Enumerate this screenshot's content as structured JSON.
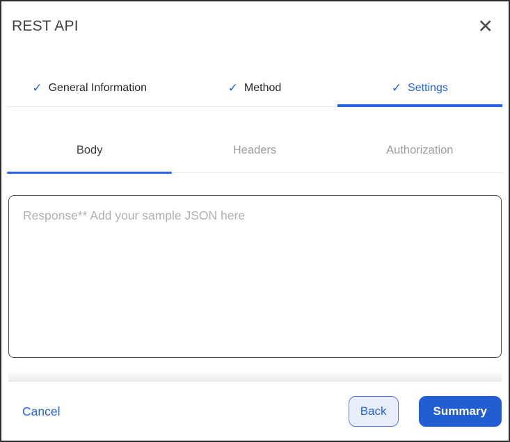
{
  "modal": {
    "title": "REST API"
  },
  "icons": {
    "close": "✕",
    "check": "✓"
  },
  "steps": [
    {
      "label": "General Information",
      "checked": true,
      "active": false
    },
    {
      "label": "Method",
      "checked": true,
      "active": false
    },
    {
      "label": "Settings",
      "checked": true,
      "active": true
    }
  ],
  "tabs": [
    {
      "label": "Body",
      "active": true
    },
    {
      "label": "Headers",
      "active": false
    },
    {
      "label": "Authorization",
      "active": false
    }
  ],
  "body_tab": {
    "value": "",
    "placeholder": "Response** Add your sample JSON here"
  },
  "footer": {
    "cancel_label": "Cancel",
    "back_label": "Back",
    "summary_label": "Summary"
  },
  "colors": {
    "accent": "#2563eb",
    "summary_button": "#215dd3",
    "back_button_bg": "#e8edfa",
    "inactive_tab": "#9e9e9e",
    "textarea_border": "#4a4a4a"
  }
}
